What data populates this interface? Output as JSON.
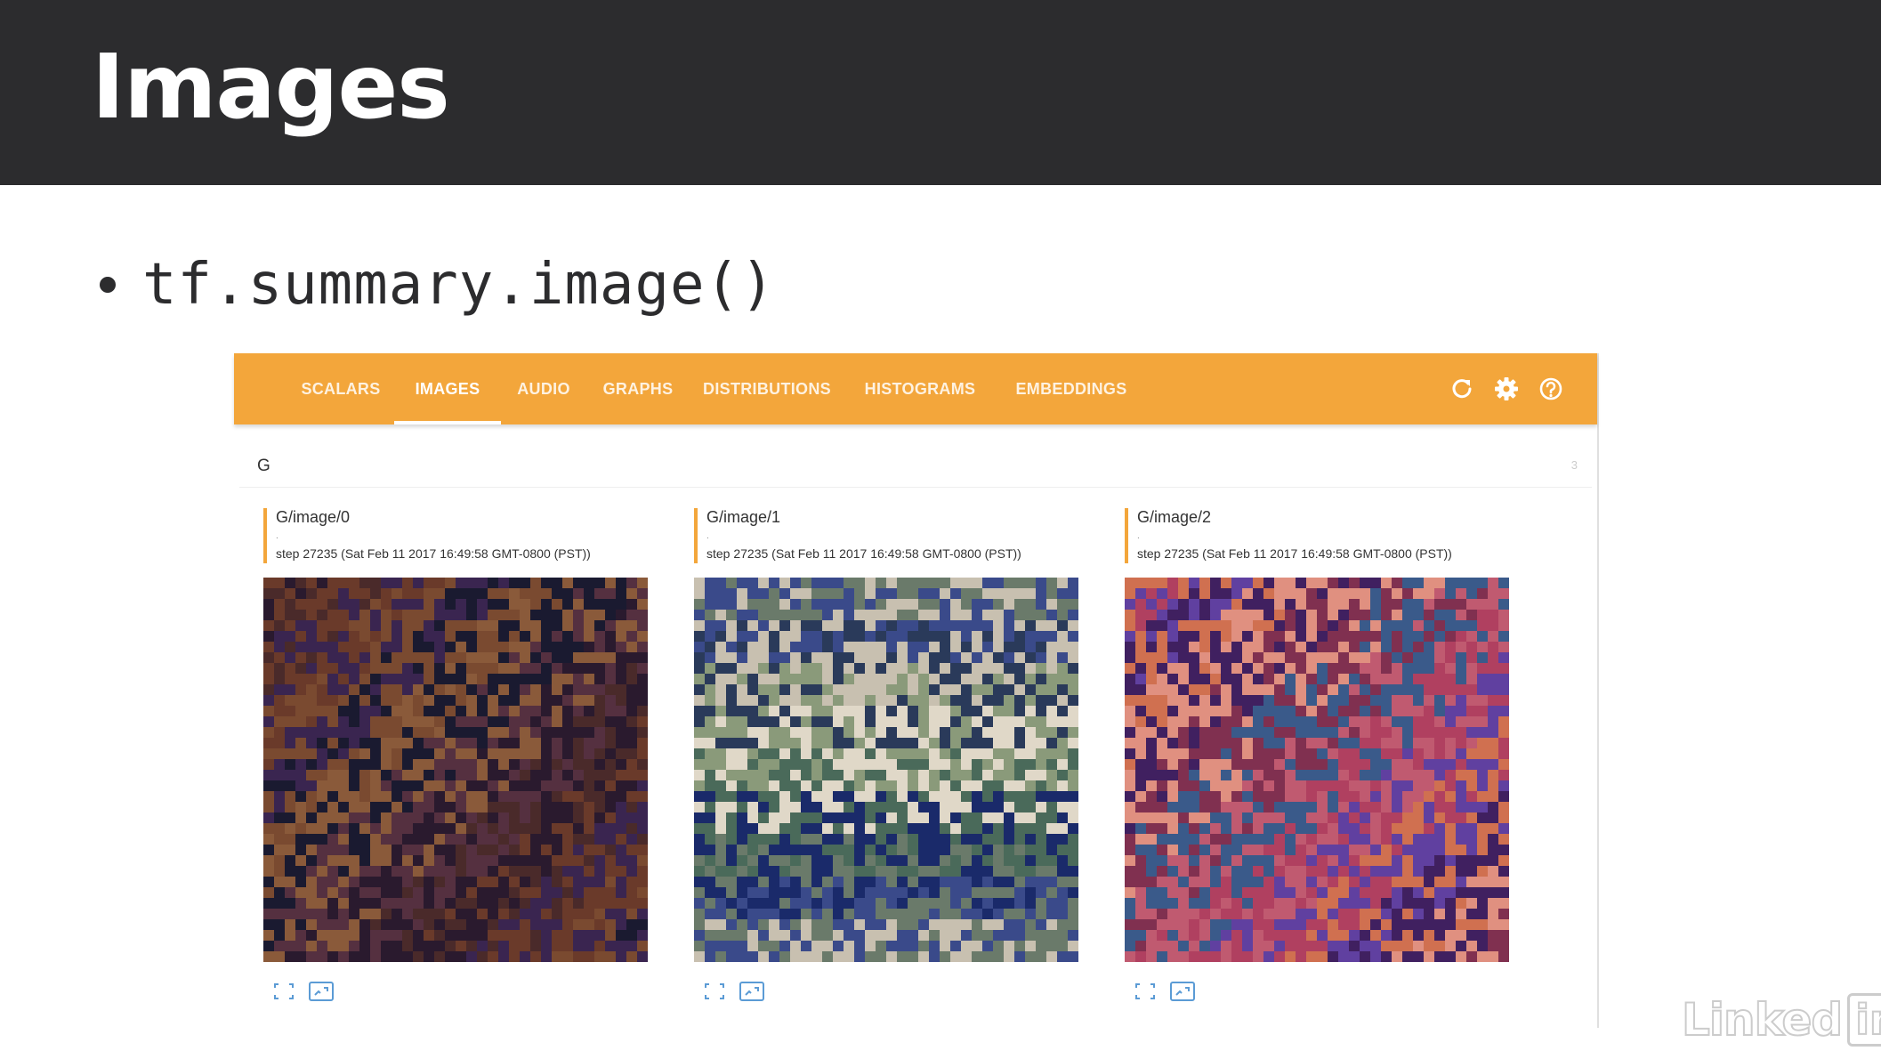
{
  "slide": {
    "title": "Images",
    "bullet": "tf.summary.image()"
  },
  "tensorboard": {
    "tabs": [
      {
        "label": "SCALARS",
        "active": false
      },
      {
        "label": "IMAGES",
        "active": true
      },
      {
        "label": "AUDIO",
        "active": false
      },
      {
        "label": "GRAPHS",
        "active": false
      },
      {
        "label": "DISTRIBUTIONS",
        "active": false
      },
      {
        "label": "HISTOGRAMS",
        "active": false
      },
      {
        "label": "EMBEDDINGS",
        "active": false
      }
    ],
    "toolbar_icons": [
      "refresh-icon",
      "settings-icon",
      "help-icon"
    ],
    "accent_color": "#f3a63b",
    "group": {
      "name": "G",
      "count": "3"
    },
    "cards": [
      {
        "tag": "G/image/0",
        "dot": ".",
        "step": "step 27235 (Sat Feb 11 2017 16:49:58 GMT-0800 (PST))",
        "palette": [
          "#2a1a2e",
          "#4a2a2a",
          "#6a3a2a",
          "#3a2550",
          "#7a4a30",
          "#1a1a30",
          "#8a5a3a",
          "#553040"
        ]
      },
      {
        "tag": "G/image/1",
        "dot": ".",
        "step": "step 27235 (Sat Feb 11 2017 16:49:58 GMT-0800 (PST))",
        "palette": [
          "#6a7a6a",
          "#3a4a8a",
          "#c8c0b0",
          "#2a3a5a",
          "#8a9a7a",
          "#e0d8c8",
          "#4a6a5a",
          "#1a2a6a"
        ]
      },
      {
        "tag": "G/image/2",
        "dot": ".",
        "step": "step 27235 (Sat Feb 11 2017 16:49:58 GMT-0800 (PST))",
        "palette": [
          "#b04060",
          "#6040a0",
          "#d07050",
          "#402060",
          "#e09080",
          "#803050",
          "#3a5a8a",
          "#c05a70"
        ]
      }
    ],
    "card_icons": [
      "fullscreen-icon",
      "actual-size-icon"
    ]
  },
  "watermark": {
    "text": "Linked",
    "box": "in"
  }
}
